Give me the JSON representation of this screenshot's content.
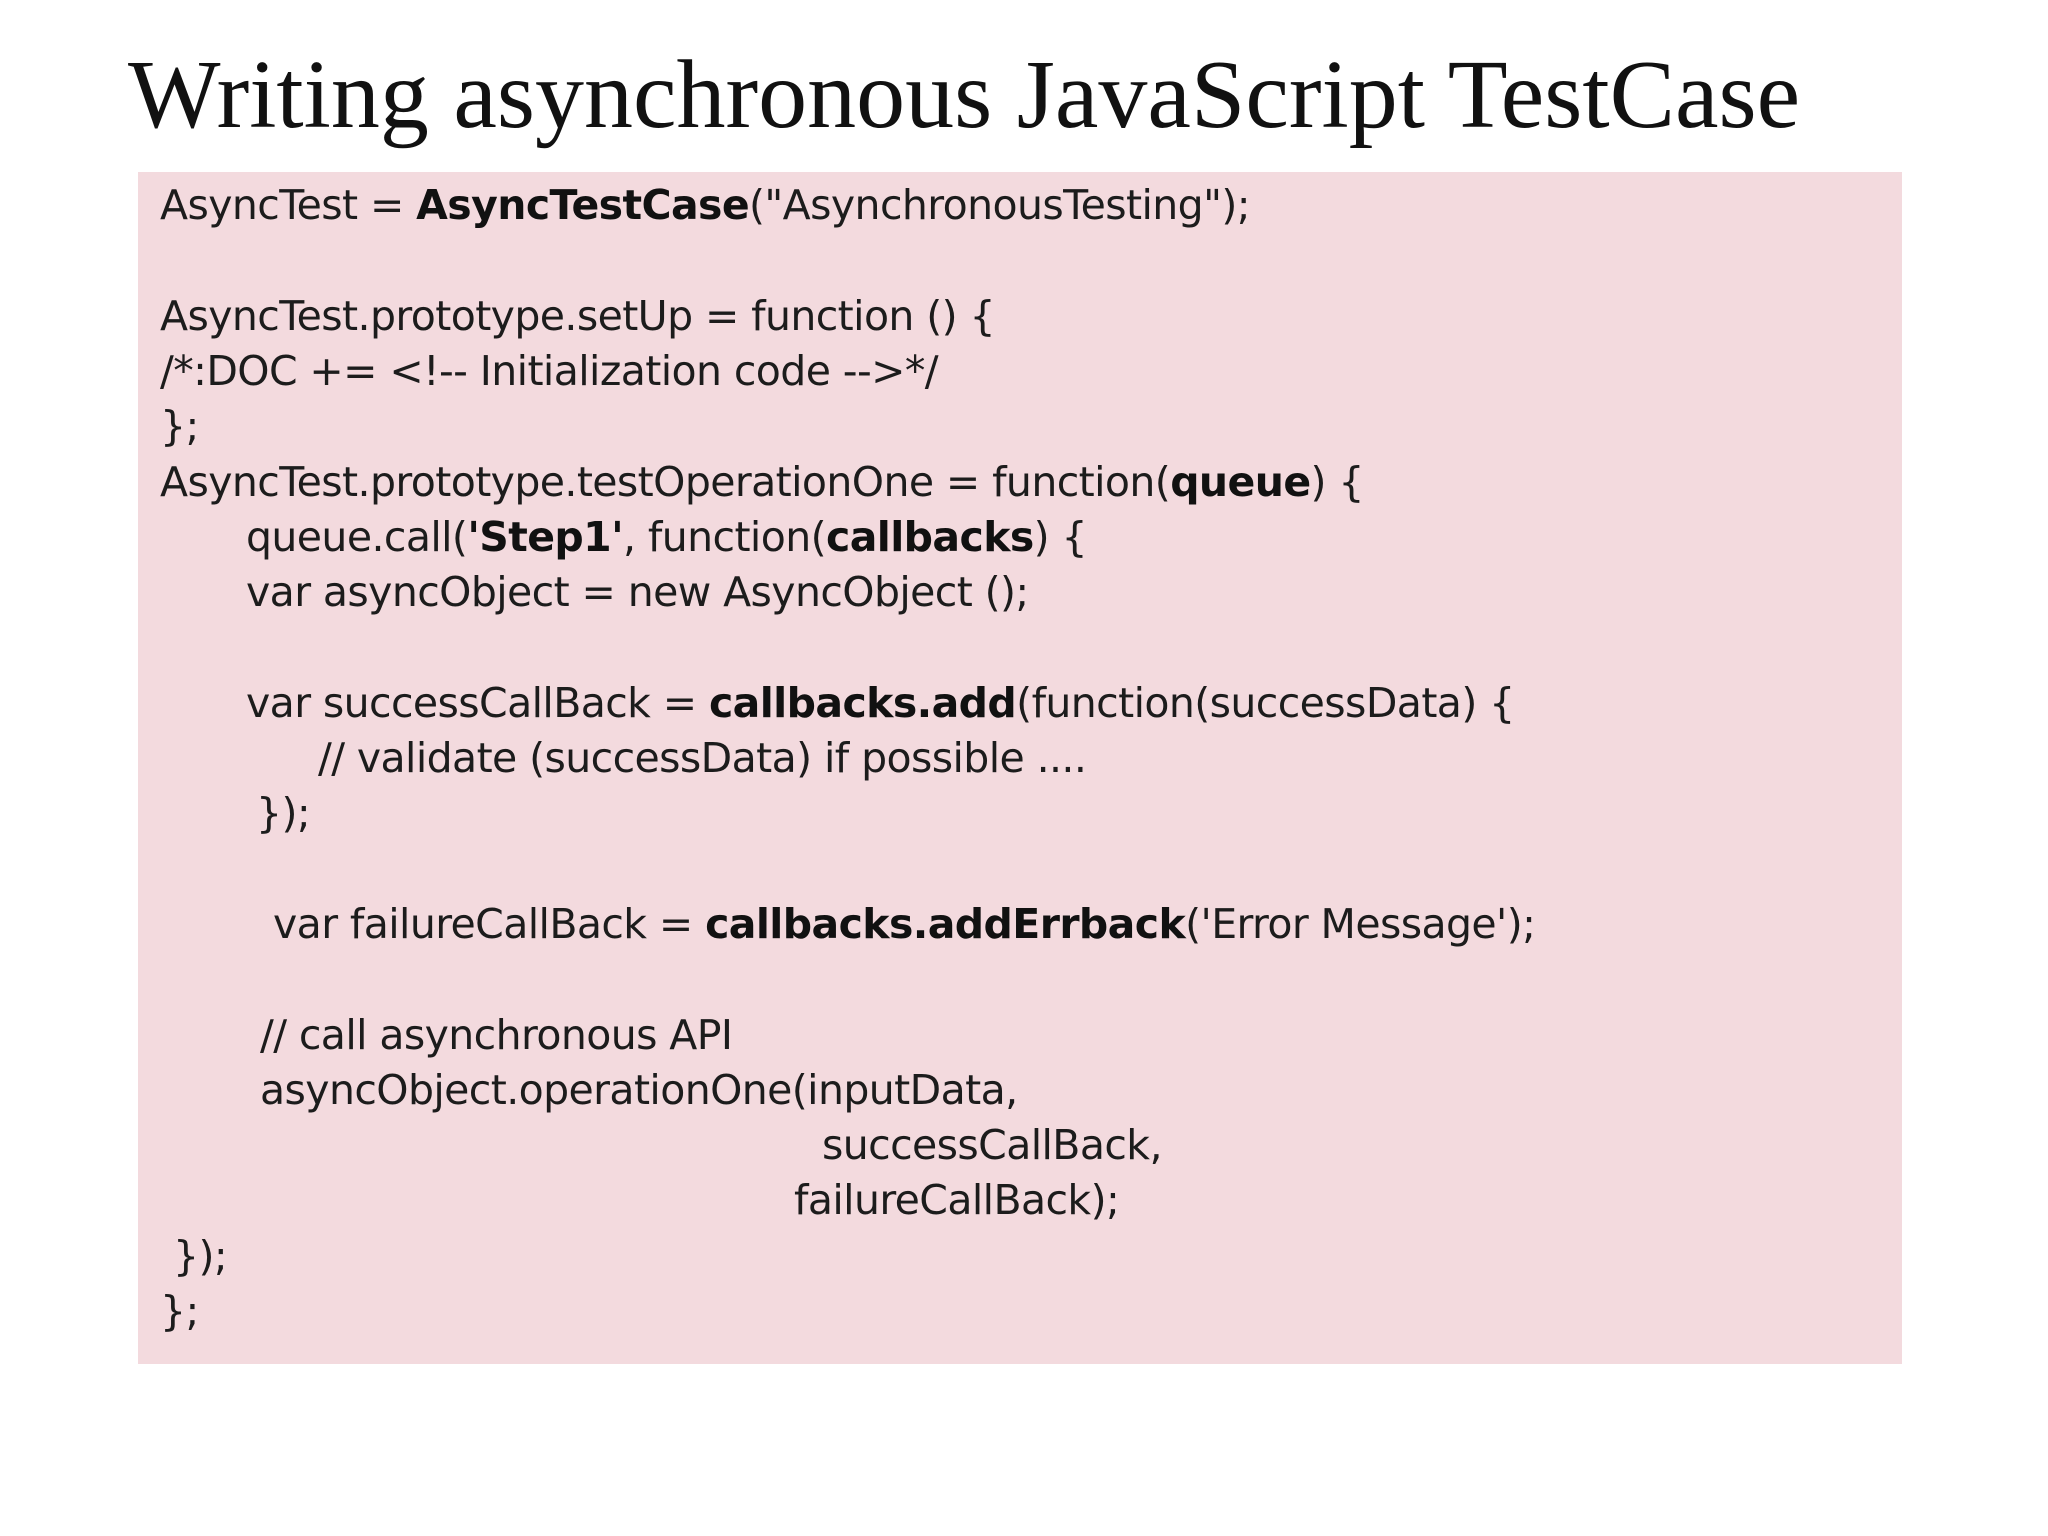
{
  "slide": {
    "title": "Writing asynchronous JavaScript TestCase"
  },
  "code": {
    "line1": {
      "a": "AsyncTest = ",
      "b": "AsyncTestCase",
      "c": "(\"AsynchronousTesting\");"
    },
    "line2": "AsyncTest.prototype.setUp = function () {",
    "line3": "/*:DOC += <!-- Initialization code -->*/",
    "line4": "};",
    "line5": {
      "a": "AsyncTest.prototype.testOperationOne = function(",
      "b": "queue",
      "c": ") {"
    },
    "line6": {
      "a": "queue.call(",
      "b": "'Step1'",
      "c": ", function(",
      "d": "callbacks",
      "e": ") {"
    },
    "line7": "var asyncObject = new AsyncObject ();",
    "line8": {
      "a": "var successCallBack = ",
      "b": "callbacks.add",
      "c": "(function(successData) {"
    },
    "line9": "// validate (successData) if possible ....",
    "line10": "});",
    "line11": {
      "a": "var failureCallBack = ",
      "b": "callbacks.addErrback",
      "c": "('Error Message');"
    },
    "line12": "// call asynchronous API",
    "line13": "asyncObject.operationOne(inputData,",
    "line14": "successCallBack,",
    "line15": "failureCallBack);",
    "line16": "});",
    "line17": "};"
  }
}
